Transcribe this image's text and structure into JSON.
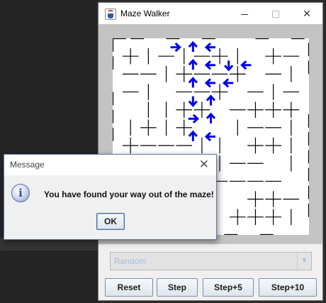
{
  "window": {
    "title": "Maze Walker",
    "controls": {
      "minimize": "minimize",
      "maximize": "maximize",
      "close": "✕"
    }
  },
  "maze": {
    "rows": 11,
    "cols": 11,
    "arrows": [
      {
        "row": 0,
        "col": 3,
        "dir": "right"
      },
      {
        "row": 0,
        "col": 4,
        "dir": "up"
      },
      {
        "row": 0,
        "col": 5,
        "dir": "left"
      },
      {
        "row": 1,
        "col": 4,
        "dir": "up"
      },
      {
        "row": 1,
        "col": 5,
        "dir": "left"
      },
      {
        "row": 1,
        "col": 6,
        "dir": "down"
      },
      {
        "row": 1,
        "col": 7,
        "dir": "left"
      },
      {
        "row": 2,
        "col": 4,
        "dir": "up"
      },
      {
        "row": 2,
        "col": 5,
        "dir": "left"
      },
      {
        "row": 2,
        "col": 6,
        "dir": "left"
      },
      {
        "row": 3,
        "col": 4,
        "dir": "down"
      },
      {
        "row": 3,
        "col": 5,
        "dir": "up"
      },
      {
        "row": 4,
        "col": 4,
        "dir": "right"
      },
      {
        "row": 4,
        "col": 5,
        "dir": "up"
      },
      {
        "row": 5,
        "col": 4,
        "dir": "up"
      },
      {
        "row": 5,
        "col": 5,
        "dir": "left"
      }
    ],
    "arrow_color": "#0000ee"
  },
  "controls": {
    "strategy_select": "Random",
    "buttons": {
      "reset": "Reset",
      "step": "Step",
      "step5": "Step+5",
      "step10": "Step+10"
    }
  },
  "dialog": {
    "title": "Message",
    "close": "✕",
    "icon": "info-icon",
    "message": "You have found your way out of the maze!",
    "ok": "OK"
  }
}
